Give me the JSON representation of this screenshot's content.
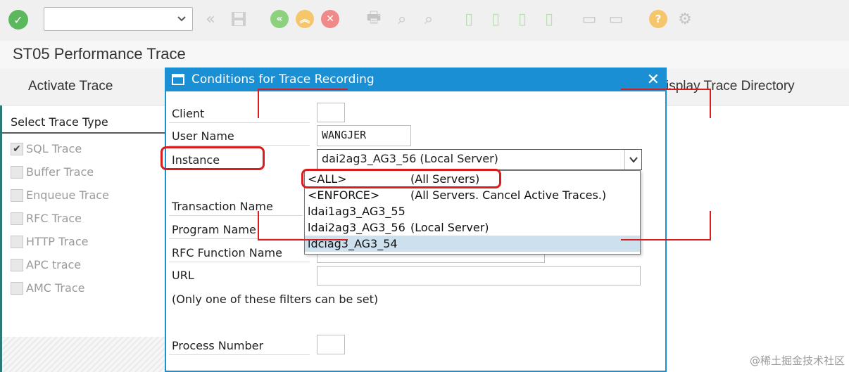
{
  "toolbar": {
    "command_value": "",
    "icons": [
      "enter-icon",
      "back-double-icon",
      "save-icon",
      "back-icon",
      "exit-icon",
      "cancel-icon",
      "print-icon",
      "find-icon",
      "find-next-icon",
      "first-page-icon",
      "previous-page-icon",
      "next-page-icon",
      "last-page-icon",
      "create-session-icon",
      "shortcut-icon",
      "help-icon",
      "settings-icon"
    ]
  },
  "page": {
    "title": "ST05 Performance Trace"
  },
  "appbar": {
    "activate_label": "Activate Trace",
    "display_dir_label": "isplay Trace Directory"
  },
  "left_panel": {
    "title": "Select Trace Type",
    "items": [
      {
        "label": "SQL Trace",
        "checked": true
      },
      {
        "label": "Buffer Trace",
        "checked": false
      },
      {
        "label": "Enqueue Trace",
        "checked": false
      },
      {
        "label": "RFC Trace",
        "checked": false
      },
      {
        "label": "HTTP Trace",
        "checked": false
      },
      {
        "label": "APC trace",
        "checked": false
      },
      {
        "label": "AMC Trace",
        "checked": false
      }
    ]
  },
  "dialog": {
    "title": "Conditions for Trace Recording",
    "close": "✕",
    "labels": {
      "client": "Client",
      "user_name": "User Name",
      "instance": "Instance",
      "transaction_name": "Transaction Name",
      "program_name": "Program Name",
      "rfc_function_name": "RFC Function Name",
      "url": "URL",
      "filter_note": "(Only one of these filters can be set)",
      "process_number": "Process Number"
    },
    "values": {
      "client": "",
      "user_name": "WANGJER",
      "instance": "dai2ag3_AG3_56 (Local Server)"
    },
    "instance_options": [
      {
        "key": "<ALL>",
        "desc": "(All Servers)"
      },
      {
        "key": "<ENFORCE>",
        "desc": "(All Servers. Cancel Active Traces.)"
      },
      {
        "key": "ldai1ag3_AG3_55",
        "desc": ""
      },
      {
        "key": "ldai2ag3_AG3_56",
        "desc": "(Local Server)"
      },
      {
        "key": "ldciag3_AG3_54",
        "desc": ""
      }
    ]
  },
  "watermark": "@稀土掘金技术社区",
  "colors": {
    "dialog_blue": "#1a8fd4",
    "annotation_red": "#d91c1c",
    "selected_row": "#cde0ee"
  }
}
